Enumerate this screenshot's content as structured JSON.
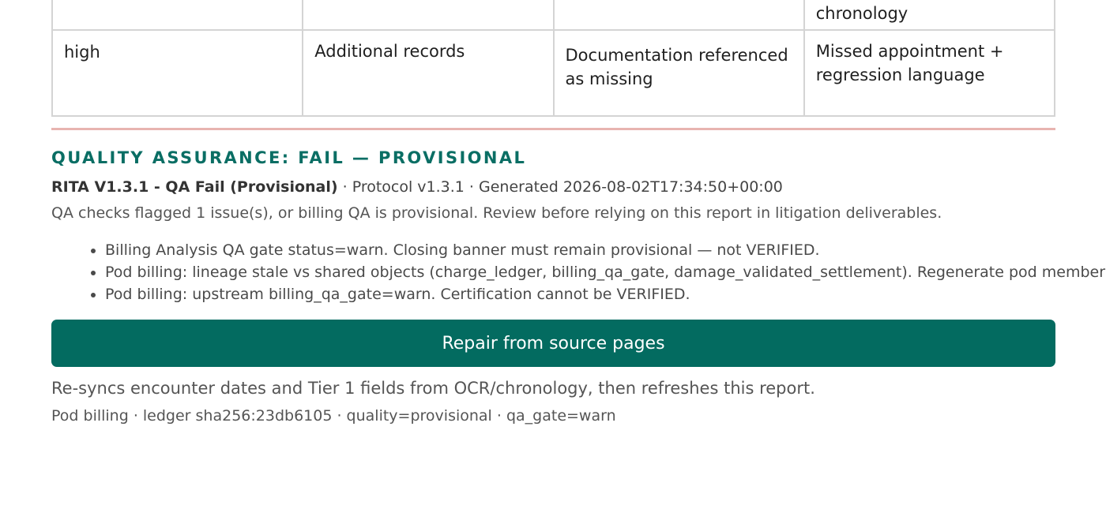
{
  "issues_table": {
    "previous_row": {
      "severity": "",
      "category": "",
      "description": "",
      "note_tail": "chronology"
    },
    "rows": [
      {
        "severity": "high",
        "category": "Additional records",
        "description": "Documentation referenced as missing",
        "note": "Missed appointment + regression language"
      }
    ]
  },
  "qa": {
    "heading": "QUALITY ASSURANCE: FAIL — PROVISIONAL",
    "badge": "RITA V1.3.1 - QA Fail (Provisional)",
    "meta": " · Protocol v1.3.1 · Generated 2026-08-02T17:34:50+00:00",
    "summary": "QA checks flagged 1 issue(s), or billing QA is provisional. Review before relying on this report in litigation deliverables.",
    "issues": [
      "Billing Analysis QA gate status=warn. Closing banner must remain provisional — not VERIFIED.",
      "Pod billing: lineage stale vs shared objects (charge_ledger, billing_qa_gate, damage_validated_settlement). Regenerate pod members.",
      "Pod billing: upstream billing_qa_gate=warn. Certification cannot be VERIFIED."
    ],
    "repair_button_label": "Repair from source pages",
    "repair_note": "Re-syncs encounter dates and Tier 1 fields from OCR/chronology, then refreshes this report.",
    "pod_footer": "Pod billing · ledger sha256:23db6105 · quality=provisional · qa_gate=warn"
  },
  "colors": {
    "accent": "#036b60",
    "heading": "#0a6e64",
    "rule": "#e8b4b0"
  }
}
